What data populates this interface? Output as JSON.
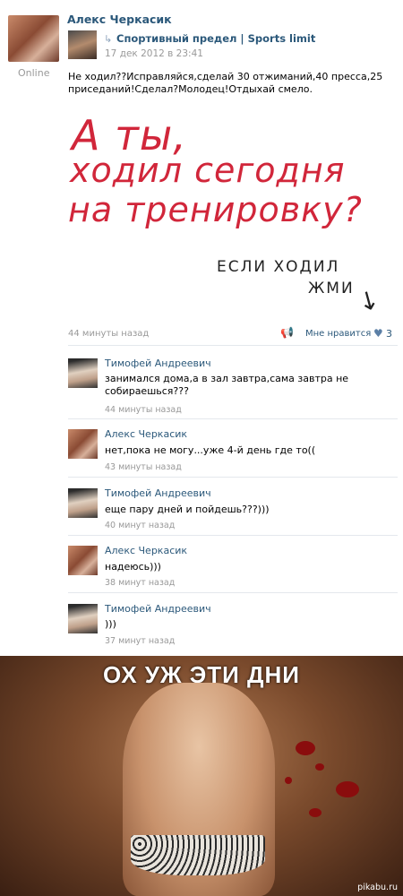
{
  "post": {
    "author": "Алекс Черкасик",
    "status": "Online",
    "repost_source": "Спортивный предел | Sports limit",
    "repost_date": "17 дек 2012 в 23:41",
    "text": "Не ходил??Исправляйся,сделай 30 отжиманий,40 пресса,25 приседаний!Сделал?Молодец!Отдыхай смело.",
    "image_text": {
      "line1": "А ты,",
      "line2": "ходил сегодня",
      "line3": "на тренировку?",
      "small1": "ЕСЛИ ХОДИЛ",
      "small2": "ЖМИ"
    },
    "time_ago": "44 минуты назад",
    "like_label": "Мне нравится",
    "like_count": "3"
  },
  "comments": [
    {
      "author": "Тимофей Андреевич",
      "text": "занимался дома,а в зал завтра,сама завтра не собираешься???",
      "time": "44 минуты назад"
    },
    {
      "author": "Алекс Черкасик",
      "text": "нет,пока не могу...уже 4-й день где то((",
      "time": "43 минуты назад"
    },
    {
      "author": "Тимофей Андреевич",
      "text": "еще пару дней и пойдешь???)))",
      "time": "40 минут назад"
    },
    {
      "author": "Алекс Черкасик",
      "text": "надеюсь)))",
      "time": "38 минут назад"
    },
    {
      "author": "Тимофей Андреевич",
      "text": ")))",
      "time": "37 минут назад"
    }
  ],
  "photo": {
    "title": "ОХ УЖ ЭТИ ДНИ",
    "watermark": "pikabu.ru"
  },
  "icons": {
    "repost": "repost-arrow-icon",
    "tell_friends": "megaphone-icon",
    "like": "heart-icon"
  },
  "colors": {
    "link": "#2b587a",
    "muted": "#999999",
    "accent_red": "#d1263a"
  }
}
